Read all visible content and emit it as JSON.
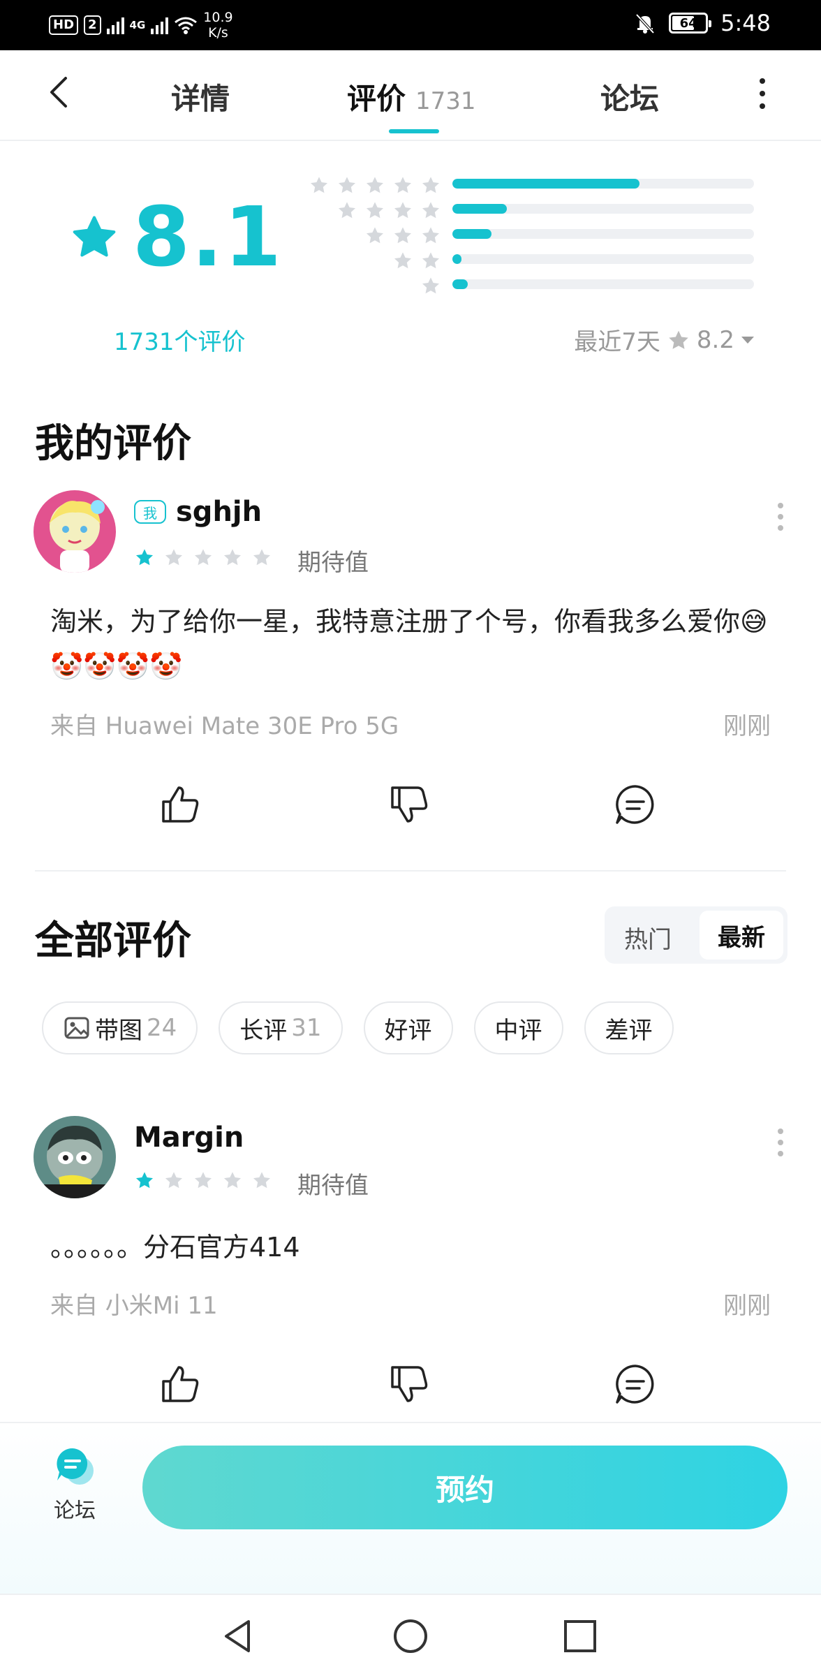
{
  "status_bar": {
    "hd_label": "HD",
    "sim_label": "2",
    "net_label": "4G",
    "speed_value": "10.9",
    "speed_unit": "K/s",
    "battery": "64",
    "time": "5:48"
  },
  "nav": {
    "tabs": [
      {
        "label": "详情"
      },
      {
        "label": "评价",
        "count": "1731"
      },
      {
        "label": "论坛"
      }
    ],
    "active_tab": "评价"
  },
  "rating": {
    "score": "8.1",
    "count_label": "1731个评价",
    "distribution": [
      {
        "stars": 5,
        "fraction": 0.62
      },
      {
        "stars": 4,
        "fraction": 0.18
      },
      {
        "stars": 3,
        "fraction": 0.13
      },
      {
        "stars": 2,
        "fraction": 0.03
      },
      {
        "stars": 1,
        "fraction": 0.05
      }
    ],
    "recent_label": "最近7天",
    "recent_score": "8.2"
  },
  "my_review": {
    "section_title": "我的评价",
    "me_badge": "我",
    "username": "sghjh",
    "stars": 1,
    "tag": "期待值",
    "text": "淘米，为了给你一星，我特意注册了个号，你看我多么爱你😅🤡🤡🤡🤡",
    "device": "来自 Huawei Mate 30E Pro 5G",
    "time": "刚刚"
  },
  "all_reviews": {
    "section_title": "全部评价",
    "sort_options": [
      "热门",
      "最新"
    ],
    "sort_selected": "最新",
    "filters": [
      {
        "label": "带图",
        "count": "24",
        "icon": "image-icon"
      },
      {
        "label": "长评",
        "count": "31"
      },
      {
        "label": "好评"
      },
      {
        "label": "中评"
      },
      {
        "label": "差评"
      }
    ],
    "reviews": [
      {
        "username": "Margin",
        "stars": 1,
        "tag": "期待值",
        "text": "。。。。。。分石官方414",
        "device": "来自 小米Mi 11",
        "time": "刚刚"
      }
    ]
  },
  "bottom_bar": {
    "forum_label": "论坛",
    "cta_label": "预约"
  },
  "colors": {
    "accent": "#16c2cf",
    "star_inactive": "#d5d8dc"
  }
}
